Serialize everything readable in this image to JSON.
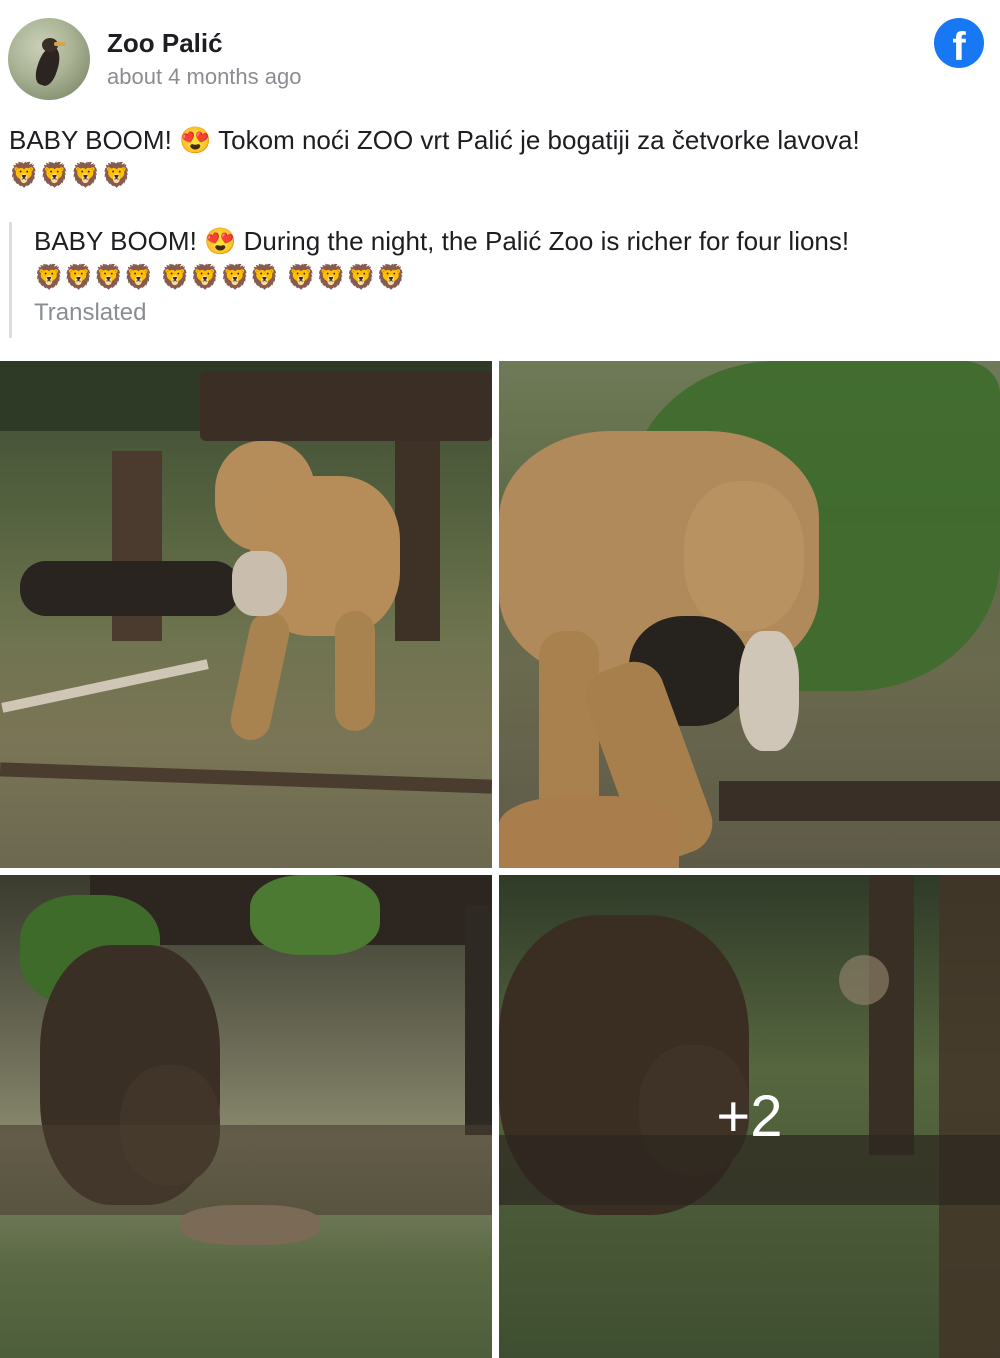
{
  "post": {
    "page_name": "Zoo Palić",
    "timestamp": "about 4 months ago",
    "text": "BABY BOOM! 😍 Tokom noći ZOO vrt Palić je bogatiji za četvorke lavova!",
    "text_emojis": "🦁🦁🦁🦁",
    "translation": {
      "text": "BABY BOOM! 😍 During the night, the Palić Zoo is richer for four lions!",
      "emojis": "🦁🦁🦁🦁 🦁🦁🦁🦁 🦁🦁🦁🦁",
      "label": "Translated"
    }
  },
  "icons": {
    "brand": "facebook-logo",
    "brand_color": "#1877f2"
  },
  "photos": {
    "items": [
      {
        "subject": "lioness carrying cub"
      },
      {
        "subject": "lioness carrying cub close"
      },
      {
        "subject": "lioness under log"
      },
      {
        "subject": "lioness sniffing ground"
      }
    ],
    "more_count": "+2"
  }
}
